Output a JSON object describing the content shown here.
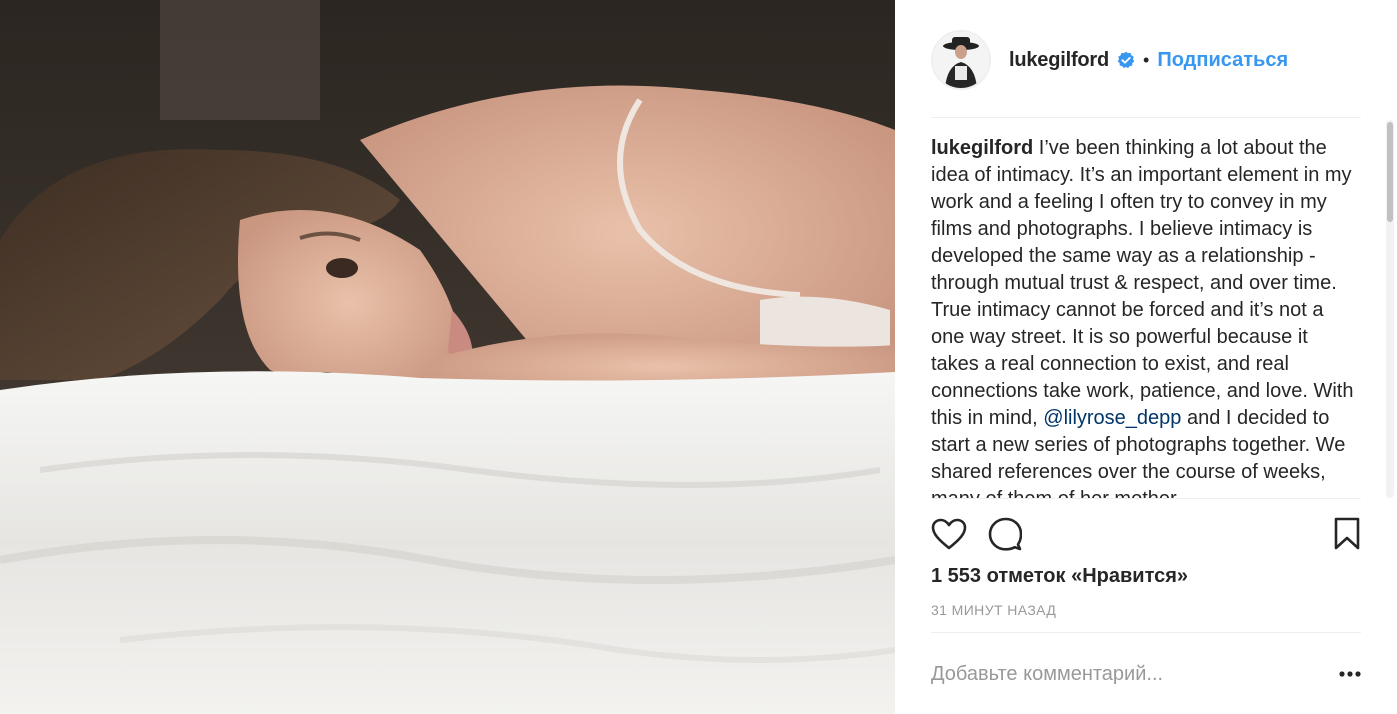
{
  "post": {
    "username": "lukegilford",
    "verified": true,
    "separator": "•",
    "follow_label": "Подписаться",
    "caption_username": "lukegilford",
    "caption_part1": " I’ve been thinking a lot about the idea of intimacy. It’s an important element in my work and a feeling I often try to convey in my films and photographs. I believe intimacy is developed the same way as a relationship - through mutual trust & respect, and over time. True intimacy cannot be forced and it’s not a one way street. It is so powerful because it takes a real connection to exist, and real connections take work, patience, and love. With this in mind, ",
    "mention": "@lilyrose_depp",
    "caption_part2": " and I decided to start a new series of photographs together. We shared references over the course of weeks, many of them of her mother",
    "likes_text": "1 553 отметок «Нравится»",
    "time_ago": "31 МИНУТ НАЗАД",
    "comment_placeholder": "Добавьте комментарий..."
  },
  "icons": {
    "like": "heart-icon",
    "comment": "comment-bubble-icon",
    "save": "bookmark-icon",
    "more": "more-options-icon",
    "verified": "verified-badge-icon"
  },
  "colors": {
    "accent": "#3897f0",
    "mention": "#003569",
    "text": "#262626",
    "muted": "#999999"
  }
}
